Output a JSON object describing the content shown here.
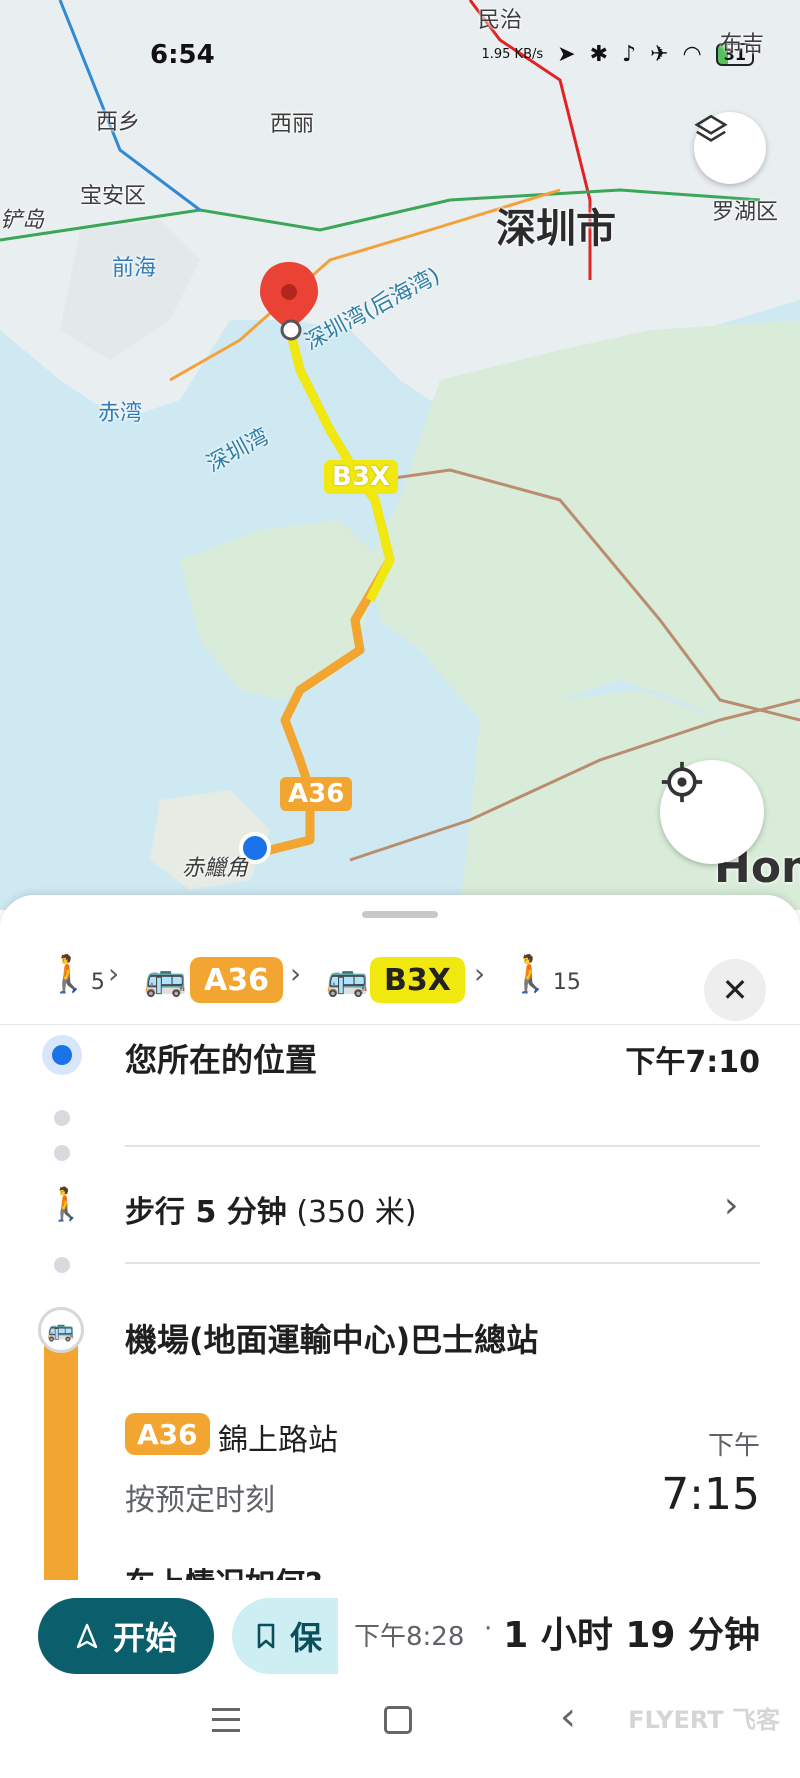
{
  "status_bar": {
    "time": "6:54",
    "net_speed": "1.95 KB/s",
    "battery": "31"
  },
  "map": {
    "labels": {
      "minzhi": "民治",
      "buji": "布吉",
      "xixiang": "西乡",
      "xili": "西丽",
      "baoan": "宝安区",
      "shenzhen": "深圳市",
      "luohu": "罗湖区",
      "qianhai": "前海",
      "chiwan": "赤湾",
      "chanchu": "铲岛",
      "shenzhen_bay_houhai": "深圳湾(后海湾)",
      "shenzhen_bay": "深圳湾",
      "chek_lap_kok": "赤鱲角",
      "hong_kong_partial": "Hon"
    },
    "route_badges": {
      "b3x": "B3X",
      "a36": "A36"
    },
    "colors": {
      "b3x": "#f1e80f",
      "a36": "#f2a531",
      "water": "#cfe9f3",
      "land": "#dff0df"
    }
  },
  "sheet": {
    "steps": {
      "walk_start_min": "5",
      "bus1": "A36",
      "bus2": "B3X",
      "walk_end_min": "15"
    },
    "origin": {
      "title": "您所在的位置",
      "time": "下午7:10"
    },
    "walk": {
      "label": "步行 5 分钟",
      "distance": "(350 米)"
    },
    "station": {
      "title": "機場(地面運輸中心)巴士總站",
      "route": "A36",
      "stop": "錦上路站",
      "schedule": "按预定时刻",
      "time_period": "下午",
      "time": "7:15",
      "question": "车上情况如何?"
    }
  },
  "bottom_bar": {
    "start_label": "开始",
    "save_label": "保",
    "arrival": "下午8:28",
    "separator": "·",
    "duration": "1 小时 19 分钟"
  },
  "watermark": "FLYERT 飞客"
}
